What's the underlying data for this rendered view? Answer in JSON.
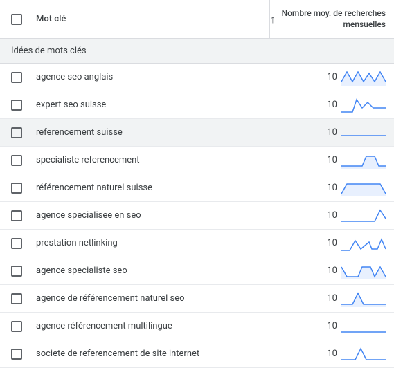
{
  "header": {
    "keyword_label": "Mot clé",
    "searches_label": "Nombre moy. de recherches mensuelles"
  },
  "group_header": "Idées de mots clés",
  "rows": [
    {
      "keyword": "agence seo anglais",
      "value": "10",
      "spark": "0,18 8,4 16,18 24,4 32,18 40,6 48,18 56,4 64,18",
      "fill": true,
      "highlight": false
    },
    {
      "keyword": "expert seo suisse",
      "value": "10",
      "spark": "0,22 16,22 22,4 30,16 38,8 46,16 56,16 64,16",
      "fill": false,
      "highlight": false
    },
    {
      "keyword": "referencement suisse",
      "value": "10",
      "spark": "0,16 64,16",
      "fill": false,
      "highlight": true
    },
    {
      "keyword": "specialiste referencement",
      "value": "10",
      "spark": "0,20 30,20 36,6 48,6 54,20 64,20",
      "fill": true,
      "highlight": false
    },
    {
      "keyword": "référencement naturel suisse",
      "value": "10",
      "spark": "0,20 8,6 56,6 64,20",
      "fill": true,
      "highlight": false
    },
    {
      "keyword": "agence specialisee en seo",
      "value": "10",
      "spark": "0,20 48,20 56,4 64,16",
      "fill": false,
      "highlight": false
    },
    {
      "keyword": "prestation netlinking",
      "value": "10",
      "spark": "0,22 12,22 20,8 28,20 40,10 44,20 52,20 58,6 64,20",
      "fill": false,
      "highlight": false
    },
    {
      "keyword": "agence specialiste seo",
      "value": "10",
      "spark": "0,6 8,20 24,20 30,6 42,6 48,20 56,6 64,20",
      "fill": true,
      "highlight": false
    },
    {
      "keyword": "agence de référencement naturel seo",
      "value": "10",
      "spark": "0,20 16,20 24,4 32,20 64,20",
      "fill": true,
      "highlight": false
    },
    {
      "keyword": "agence référencement multilingue",
      "value": "10",
      "spark": "0,20 64,20",
      "fill": false,
      "highlight": false
    },
    {
      "keyword": "societe de referencement de site internet",
      "value": "10",
      "spark": "0,20 20,20 28,4 36,20 64,20",
      "fill": false,
      "highlight": false
    }
  ]
}
